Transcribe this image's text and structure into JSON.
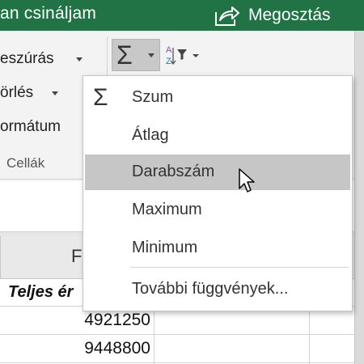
{
  "titlebar": {
    "title_fragment": "an csináljam",
    "share_label": "Megosztás",
    "share_icon": "share-icon"
  },
  "ribbon": {
    "insert_label": "eszúrás",
    "delete_label": "örlés",
    "format_label": "ormátum",
    "cells_group_label": "Cellák",
    "autosum_icon": "sigma-icon",
    "sort_filter_icon": "sort-filter-icon"
  },
  "sheet": {
    "column_header": "F",
    "header_cell": "Teljes ér",
    "rows": [
      "4921250",
      "9448800"
    ]
  },
  "menu": {
    "items": [
      {
        "label": "Szum",
        "icon": "sigma-icon"
      },
      {
        "label": "Átlag"
      },
      {
        "label": "Darabszám",
        "hover": true
      },
      {
        "label": "Maximum"
      },
      {
        "label": "Minimum"
      },
      {
        "label": "További függvények..."
      }
    ]
  },
  "colors": {
    "title_bar": "#217346",
    "menu_hover": "#c6c6c6"
  }
}
